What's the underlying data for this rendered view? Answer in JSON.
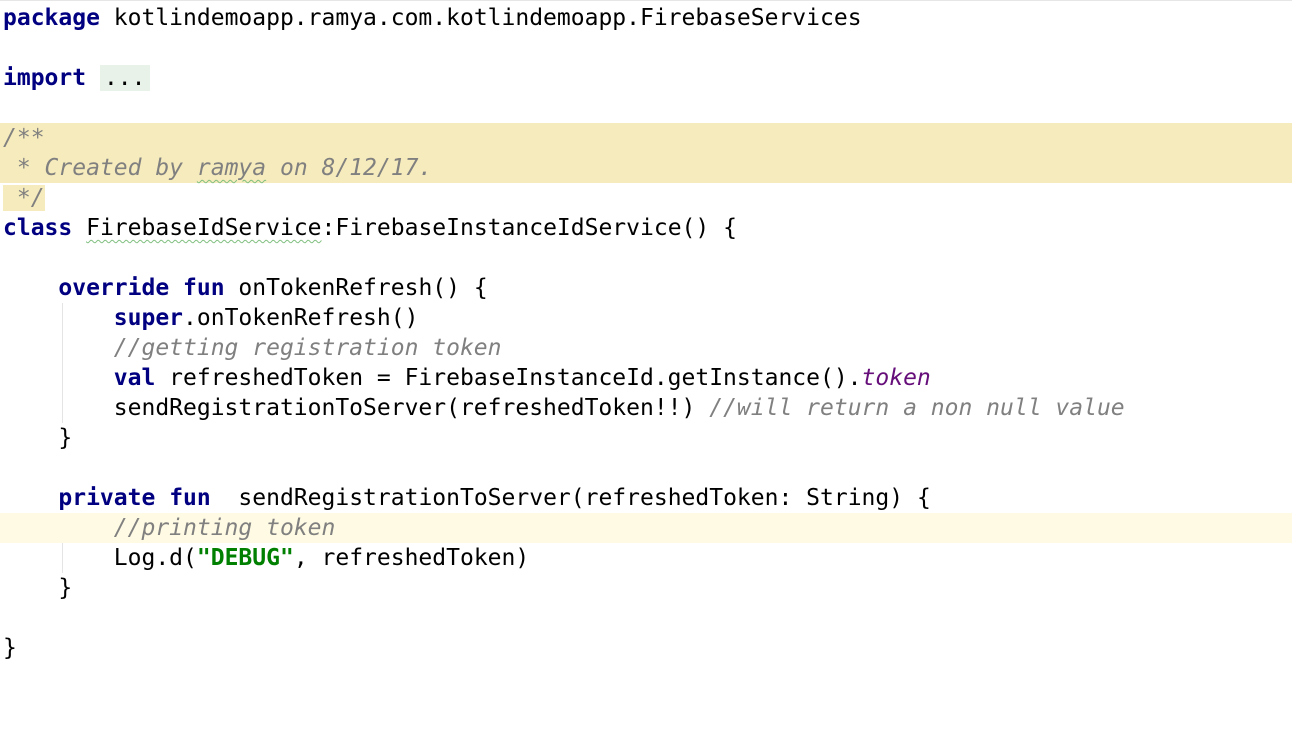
{
  "code": {
    "package_kw": "package",
    "package_name": "kotlindemoapp.ramya.com.kotlindemoapp.FirebaseServices",
    "import_kw": "import",
    "import_fold": "...",
    "doc_open": "/**",
    "doc_prefix": " * Created by ",
    "doc_author": "ramya",
    "doc_suffix": " on 8/12/17.",
    "doc_close": " */",
    "class_kw": "class",
    "class_name": "FirebaseIdService",
    "class_rest": ":FirebaseInstanceIdService() {",
    "indent1": "    ",
    "indent2": "        ",
    "override_kw": "override",
    "fun_kw": "fun",
    "on_token_sig": " onTokenRefresh() {",
    "super_kw": "super",
    "super_call": ".onTokenRefresh()",
    "comment_getting": "//getting registration token",
    "val_kw": "val",
    "val_expr": " refreshedToken = FirebaseInstanceId.getInstance().",
    "token_prop": "token",
    "send_call": "sendRegistrationToServer(refreshedToken!!) ",
    "comment_non_null": "//will return a non null value",
    "close_brace": "}",
    "private_kw": "private",
    "send_sig": "  sendRegistrationToServer(refreshedToken: String) {",
    "comment_printing": "//printing token",
    "log_open": "Log.d(",
    "log_tag": "\"DEBUG\"",
    "log_rest": ", refreshedToken)"
  }
}
